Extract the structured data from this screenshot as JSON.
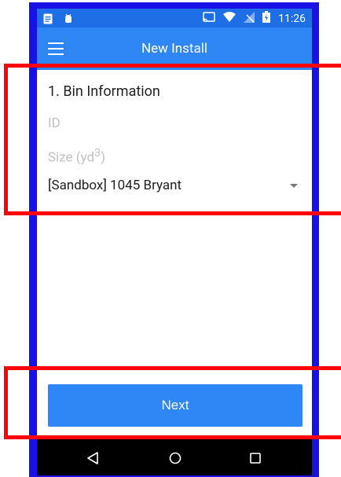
{
  "app_bar": {
    "title": "New Install"
  },
  "status_bar": {
    "time": "11:26"
  },
  "form": {
    "section_title": "1. Bin Information",
    "id_placeholder": "ID",
    "size_placeholder": "Size (yd",
    "size_superscript": "3",
    "size_suffix": ")",
    "location_value": "[Sandbox] 1045 Bryant"
  },
  "actions": {
    "next_label": "Next"
  },
  "colors": {
    "frame": "#1a10e8",
    "status_bar": "#1e6fe6",
    "app_bar": "#2f87f5",
    "button": "#2f87f5",
    "overlay": "#ff0000"
  },
  "icons": {
    "status_left": [
      "notes-icon",
      "android-debug-icon"
    ],
    "status_right": [
      "cast-icon",
      "wifi-icon",
      "no-signal-icon",
      "battery-icon"
    ],
    "nav": [
      "back-icon",
      "home-icon",
      "recents-icon"
    ]
  }
}
